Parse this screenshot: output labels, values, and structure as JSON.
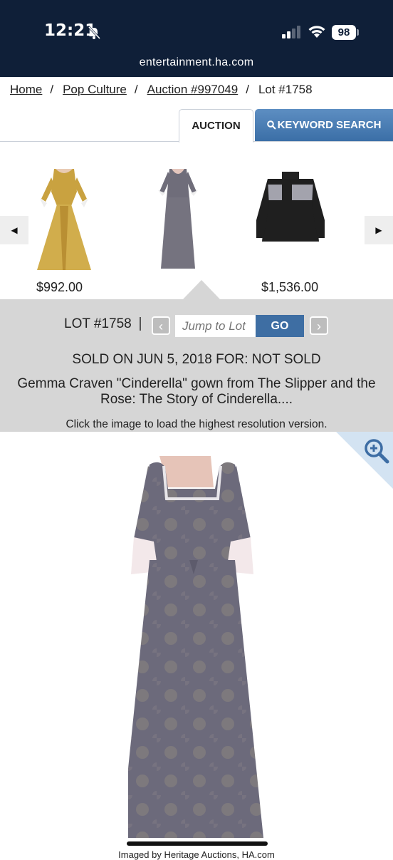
{
  "status_bar": {
    "time": "12:21",
    "battery": "98"
  },
  "browser": {
    "url": "entertainment.ha.com"
  },
  "breadcrumb": {
    "items": [
      "Home",
      "Pop Culture",
      "Auction #997049",
      "Lot #1758"
    ]
  },
  "tabs": {
    "auction": "AUCTION",
    "keyword_search": "KEYWORD SEARCH"
  },
  "carousel": {
    "prev_icon": "◀",
    "next_icon": "▶",
    "items": [
      {
        "price": "$992.00"
      },
      {
        "price": ""
      },
      {
        "price": "$1,536.00"
      }
    ]
  },
  "lot": {
    "number": "LOT #1758",
    "jump_placeholder": "Jump to Lot",
    "go_label": "GO",
    "sold_text": "SOLD ON JUN 5, 2018 FOR: NOT SOLD",
    "title": "Gemma Craven \"Cinderella\" gown from The Slipper and the Rose: The Story of Cinderella....",
    "hint": "Click the image to load the highest resolution version."
  },
  "footer": {
    "credit": "Imaged by Heritage Auctions, HA.com"
  },
  "colors": {
    "header_bg": "#0f1f38",
    "panel_bg": "#d6d6d6",
    "accent": "#3e6ea3"
  }
}
